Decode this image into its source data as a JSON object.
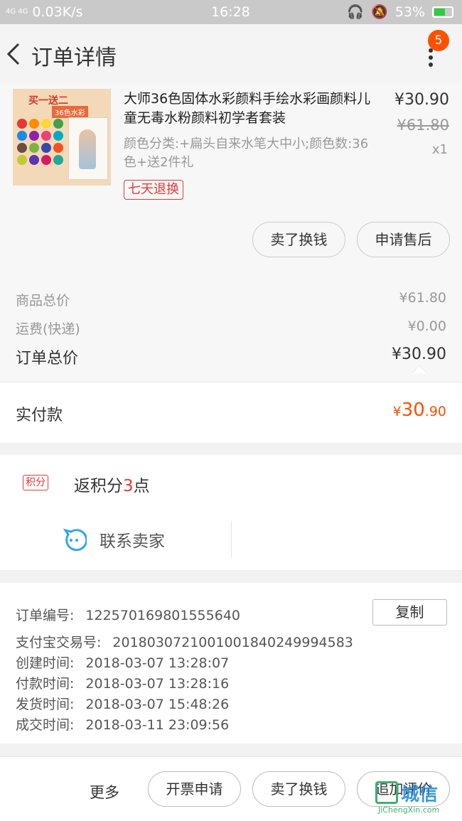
{
  "status": {
    "network": "4G 4G",
    "speed": "0.03K/s",
    "time": "16:28",
    "battery": "53%"
  },
  "header": {
    "title": "订单详情",
    "badge": "5"
  },
  "product": {
    "thumb_ribbon": "买一送二",
    "thumb_sub": "36色水彩",
    "name": "大师36色固体水彩颜料手绘水彩画颜料儿童无毒水粉颜料初学者套装",
    "attrs": "颜色分类:+扁头自来水笔大中小;颜色数:36色+送2件礼",
    "tag": "七天退换",
    "price": "¥30.90",
    "original_price": "¥61.80",
    "quantity": "x1",
    "buttons": {
      "sell": "卖了换钱",
      "after_sale": "申请售后"
    }
  },
  "totals": {
    "goods_label": "商品总价",
    "goods_value": "¥61.80",
    "shipping_label": "运费(快递)",
    "shipping_value": "¥0.00",
    "order_label": "订单总价",
    "order_value": "¥30.90",
    "paid_label": "实付款",
    "paid_symbol": "¥",
    "paid_int": "30",
    "paid_dec": ".90"
  },
  "points": {
    "tag": "积分",
    "text_prefix": "返积分",
    "count": "3",
    "text_suffix": "点"
  },
  "contact": {
    "label": "联系卖家"
  },
  "order_info": {
    "rows": [
      {
        "label": "订单编号:",
        "value": "122570169801555640"
      },
      {
        "label": "支付宝交易号:",
        "value": "2018030721001001840249994583"
      },
      {
        "label": "创建时间:",
        "value": "2018-03-07 13:28:07"
      },
      {
        "label": "付款时间:",
        "value": "2018-03-07 13:28:16"
      },
      {
        "label": "发货时间:",
        "value": "2018-03-07 15:48:26"
      },
      {
        "label": "成交时间:",
        "value": "2018-03-11 23:09:56"
      }
    ],
    "copy_label": "复制"
  },
  "bottom": {
    "more": "更多",
    "invoice": "开票申请",
    "sell": "卖了换钱",
    "review": "追加评价"
  },
  "watermark": {
    "cn": "城信",
    "en": "JiChengXin.com"
  },
  "colors": {
    "accent": "#ff5000",
    "tag_red": "#e4393c"
  }
}
